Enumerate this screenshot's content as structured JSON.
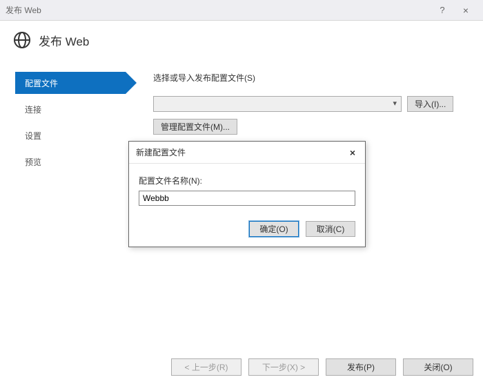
{
  "titlebar": {
    "title": "发布 Web"
  },
  "header": {
    "title": "发布 Web"
  },
  "sidebar": {
    "items": [
      {
        "label": "配置文件"
      },
      {
        "label": "连接"
      },
      {
        "label": "设置"
      },
      {
        "label": "预览"
      }
    ]
  },
  "main": {
    "section_label": "选择或导入发布配置文件(S)",
    "import_label": "导入(I)...",
    "manage_label": "管理配置文件(M)..."
  },
  "modal": {
    "title": "新建配置文件",
    "field_label": "配置文件名称(N):",
    "field_value": "Webbb",
    "ok": "确定(O)",
    "cancel": "取消(C)"
  },
  "footer": {
    "prev": "< 上一步(R)",
    "next": "下一步(X) >",
    "publish": "发布(P)",
    "close": "关闭(O)"
  }
}
